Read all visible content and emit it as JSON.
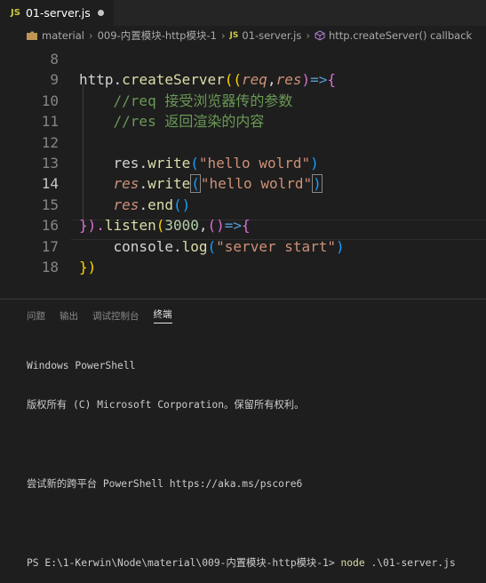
{
  "tab": {
    "badge": "JS",
    "title": "01-server.js"
  },
  "breadcrumb": {
    "folder1": "material",
    "folder2": "009-内置模块-http模块-1",
    "file_badge": "JS",
    "file": "01-server.js",
    "symbol": "http.createServer() callback"
  },
  "editor": {
    "line_numbers": [
      "8",
      "9",
      "10",
      "11",
      "12",
      "13",
      "14",
      "15",
      "16",
      "17",
      "18"
    ],
    "active_line": "14"
  },
  "code": {
    "l9_http": "http",
    "l9_dot": ".",
    "l9_fn": "createServer",
    "l9_p1": "((",
    "l9_req": "req",
    "l9_comma": ",",
    "l9_res": "res",
    "l9_p2": ")",
    "l9_arrow": "=>",
    "l9_brace": "{",
    "l10": "//req 接受浏览器传的参数",
    "l11": "//res 返回渲染的内容",
    "l13_res": "res",
    "l13_dot": ".",
    "l13_fn": "write",
    "l13_p1": "(",
    "l13_str": "\"hello wolrd\"",
    "l13_p2": ")",
    "l14_res": "res",
    "l14_dot": ".",
    "l14_fn": "write",
    "l14_p1": "(",
    "l14_str": "\"hello wolrd\"",
    "l14_p2": ")",
    "l15_res": "res",
    "l15_dot": ".",
    "l15_fn": "end",
    "l15_p": "()",
    "l16_a": "}).",
    "l16_fn": "listen",
    "l16_p1": "(",
    "l16_num": "3000",
    "l16_comma": ",",
    "l16_p2": "()",
    "l16_arrow": "=>",
    "l16_brace": "{",
    "l17_console": "console",
    "l17_dot": ".",
    "l17_fn": "log",
    "l17_p1": "(",
    "l17_str": "\"server start\"",
    "l17_p2": ")",
    "l18": "})"
  },
  "panel": {
    "tabs": [
      "问题",
      "输出",
      "调试控制台",
      "终端"
    ],
    "active": "终端"
  },
  "terminal": {
    "line1": "Windows PowerShell",
    "line2": "版权所有 (C) Microsoft Corporation。保留所有权利。",
    "line3": "尝试新的跨平台 PowerShell https://aka.ms/pscore6",
    "prompt": "PS E:\\1-Kerwin\\Node\\material\\009-内置模块-http模块-1> ",
    "cmd": "node",
    "arg": " .\\01-server.js"
  },
  "colors": {
    "keyword_fn": "#dcdcaa",
    "param": "#ce9178",
    "comment": "#6a9955",
    "string": "#ce9178",
    "number": "#b5cea8",
    "variable": "#9cdcfe",
    "brace_gold": "#ffd700",
    "brace_pink": "#da70d6"
  }
}
